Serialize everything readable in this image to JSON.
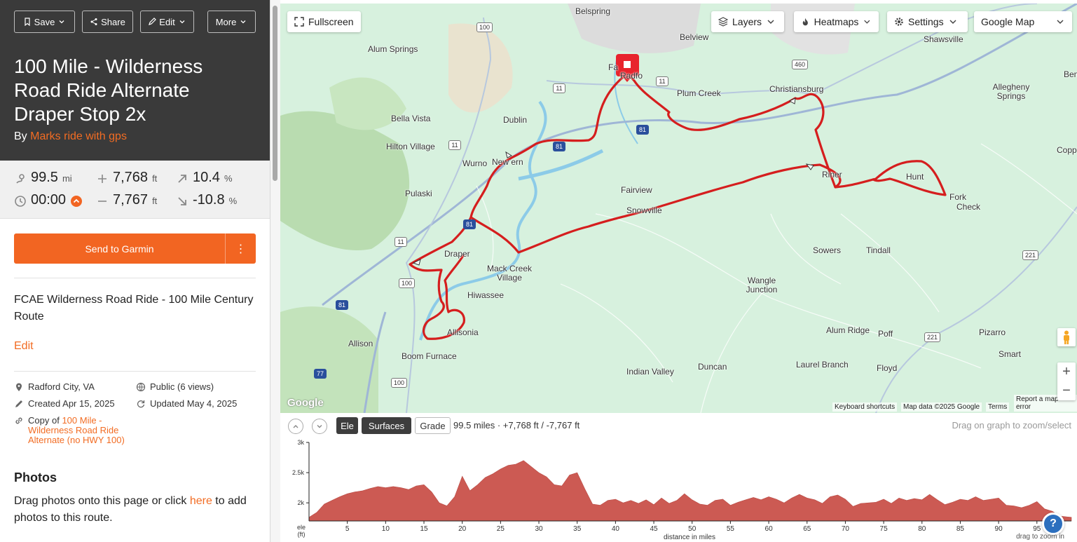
{
  "toolbar": {
    "save_label": "Save",
    "share_label": "Share",
    "edit_label": "Edit",
    "more_label": "More"
  },
  "route": {
    "title": "100 Mile - Wilderness Road Ride Alternate Draper Stop 2x",
    "by_prefix": "By",
    "author": "Marks ride with gps"
  },
  "stats": {
    "distance": "99.5",
    "distance_unit": "mi",
    "elevation_gain": "7,768",
    "elevation_gain_unit": "ft",
    "max_grade": "10.4",
    "max_grade_unit": "%",
    "time": "00:00",
    "elevation_loss": "7,767",
    "elevation_loss_unit": "ft",
    "min_grade": "-10.8",
    "min_grade_unit": "%"
  },
  "actions": {
    "send_garmin": "Send to Garmin",
    "more_menu": "⋮"
  },
  "description": "FCAE Wilderness Road Ride - 100 Mile Century Route",
  "edit_link": "Edit",
  "meta": {
    "location": "Radford City, VA",
    "visibility": "Public (6 views)",
    "created": "Created Apr 15, 2025",
    "updated": "Updated May 4, 2025",
    "copy_prefix": "Copy of",
    "copy_link": "100 Mile - Wilderness Road Ride Alternate (no HWY 100)"
  },
  "photos": {
    "title": "Photos",
    "hint_before": "Drag photos onto this page or click",
    "hint_link": "here",
    "hint_after": "to add photos to this route."
  },
  "map": {
    "fullscreen": "Fullscreen",
    "layers": "Layers",
    "heatmaps": "Heatmaps",
    "settings": "Settings",
    "map_type": "Google Map",
    "places": [
      {
        "name": "Belspring"
      },
      {
        "name": "Belview"
      },
      {
        "name": "Alum Springs"
      },
      {
        "name": "Fa"
      },
      {
        "name": "Radfo"
      },
      {
        "name": "Plum Creek"
      },
      {
        "name": "Christiansburg"
      },
      {
        "name": "Shawsville"
      },
      {
        "name": "Allegheny Springs"
      },
      {
        "name": "Bella Vista"
      },
      {
        "name": "Dublin"
      },
      {
        "name": "Hilton Village"
      },
      {
        "name": "Wurno"
      },
      {
        "name": "New   ern"
      },
      {
        "name": "Pulaski"
      },
      {
        "name": "Fairview"
      },
      {
        "name": "Snowville"
      },
      {
        "name": "Draper"
      },
      {
        "name": "Mack Creek Village"
      },
      {
        "name": "Hiwassee"
      },
      {
        "name": "Allisonia"
      },
      {
        "name": "Allison"
      },
      {
        "name": "Boom Furnace"
      },
      {
        "name": "Sowers"
      },
      {
        "name": "Tindall"
      },
      {
        "name": "Wangle Junction"
      },
      {
        "name": "Check"
      },
      {
        "name": "Fork"
      },
      {
        "name": "Alum Ridge"
      },
      {
        "name": "Poff"
      },
      {
        "name": "Pizarro"
      },
      {
        "name": "Smart"
      },
      {
        "name": "Indian Valley"
      },
      {
        "name": "Duncan"
      },
      {
        "name": "Laurel Branch"
      },
      {
        "name": "Floyd"
      },
      {
        "name": "Hunt"
      },
      {
        "name": "Riner"
      },
      {
        "name": "Copp"
      },
      {
        "name": "Ben"
      }
    ],
    "shields": [
      "100",
      "460",
      "11",
      "11",
      "81",
      "81",
      "11",
      "81",
      "11",
      "100",
      "81",
      "100",
      "221",
      "221",
      "77"
    ],
    "attribution": {
      "keyboard": "Keyboard shortcuts",
      "data": "Map data ©2025 Google",
      "terms": "Terms",
      "report": "Report a map error"
    },
    "google_logo": "Google",
    "zoom_in": "+",
    "zoom_out": "−"
  },
  "elevation": {
    "tab_ele": "Ele",
    "tab_surfaces": "Surfaces",
    "tab_grade": "Grade",
    "summary": "99.5 miles · +7,768 ft / -7,767 ft",
    "hint": "Drag on graph to zoom/select",
    "help": "?"
  },
  "chart_data": {
    "type": "area",
    "title": "",
    "xlabel": "distance in miles",
    "ylabel": "ele (ft)",
    "ylabel_line1": "ele",
    "ylabel_line2": "(ft)",
    "zoom_hint": "drag to zoom in",
    "xlim": [
      0,
      99.5
    ],
    "ylim": [
      1700,
      3000
    ],
    "y_ticks": [
      "3k",
      "2.5k",
      "2k"
    ],
    "y_tick_values": [
      3000,
      2500,
      2000
    ],
    "x_ticks": [
      5,
      10,
      15,
      20,
      25,
      30,
      35,
      40,
      45,
      50,
      55,
      60,
      65,
      70,
      75,
      80,
      85,
      90,
      95
    ],
    "color": "#cc5a53",
    "series": [
      {
        "x": [
          0,
          1,
          2,
          3,
          4,
          5,
          6,
          7,
          8,
          9,
          10,
          11,
          12,
          13,
          14,
          15,
          16,
          17,
          18,
          19,
          20,
          21,
          22,
          23,
          24,
          25,
          26,
          27,
          28,
          29,
          30,
          31,
          32,
          33,
          34,
          35,
          36,
          37,
          38,
          39,
          40,
          41,
          42,
          43,
          44,
          45,
          46,
          47,
          48,
          49,
          50,
          51,
          52,
          53,
          54,
          55,
          56,
          57,
          58,
          59,
          60,
          61,
          62,
          63,
          64,
          65,
          66,
          67,
          68,
          69,
          70,
          71,
          72,
          73,
          74,
          75,
          76,
          77,
          78,
          79,
          80,
          81,
          82,
          83,
          84,
          85,
          86,
          87,
          88,
          89,
          90,
          91,
          92,
          93,
          94,
          95,
          96,
          97,
          98,
          99.5
        ],
        "values": [
          1760,
          1840,
          1980,
          2040,
          2100,
          2150,
          2180,
          2200,
          2240,
          2270,
          2250,
          2270,
          2250,
          2220,
          2280,
          2300,
          2180,
          2000,
          1950,
          2100,
          2440,
          2200,
          2300,
          2420,
          2480,
          2560,
          2620,
          2640,
          2700,
          2600,
          2500,
          2430,
          2300,
          2280,
          2460,
          2500,
          2230,
          1980,
          1960,
          2040,
          2060,
          2000,
          2040,
          1990,
          2050,
          1970,
          2080,
          1990,
          2040,
          2150,
          2050,
          1980,
          1960,
          2040,
          2060,
          1960,
          2010,
          2050,
          2090,
          2050,
          2100,
          2060,
          2000,
          2080,
          2140,
          2080,
          2050,
          1990,
          2100,
          2130,
          2060,
          1940,
          1990,
          2000,
          2010,
          2060,
          1990,
          2080,
          2040,
          2070,
          2050,
          2140,
          2050,
          1970,
          2010,
          2060,
          2040,
          2100,
          2040,
          2060,
          2080,
          1960,
          1950,
          1920,
          1960,
          2020,
          1900,
          1860,
          1780,
          1760
        ]
      }
    ]
  }
}
